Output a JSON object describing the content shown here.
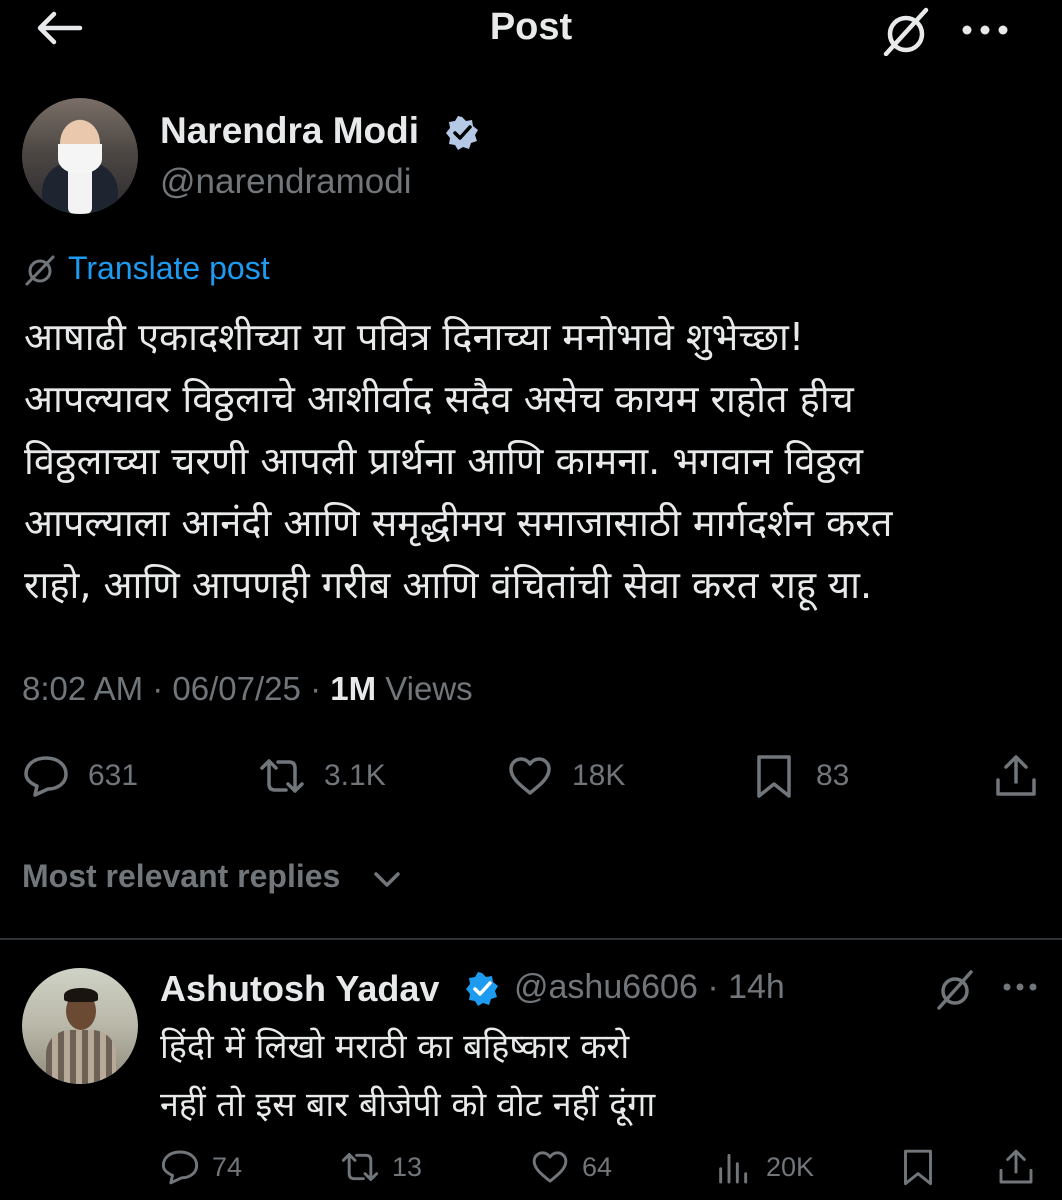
{
  "header": {
    "title": "Post"
  },
  "post": {
    "author_name": "Narendra Modi",
    "handle": "@narendramodi",
    "translate_label": "Translate post",
    "text": "आषाढी एकादशीच्या या पवित्र दिनाच्या मनोभावे शुभेच्छा!\nआपल्यावर विठ्ठलाचे आशीर्वाद सदैव असेच कायम राहोत हीच\nविठ्ठलाच्या चरणी आपली प्रार्थना आणि कामना. भगवान विठ्ठल\nआपल्याला आनंदी आणि समृद्धीमय समाजासाठी मार्गदर्शन करत\nराहो, आणि आपणही गरीब आणि वंचितांची सेवा करत राहू या.",
    "time": "8:02 AM",
    "date": "06/07/25",
    "views_count": "1M",
    "views_label": "Views",
    "stats": {
      "replies": "631",
      "reposts": "3.1K",
      "likes": "18K",
      "bookmarks": "83"
    }
  },
  "replies_section": {
    "sort_label": "Most relevant replies"
  },
  "reply": {
    "author_name": "Ashutosh Yadav",
    "handle": "@ashu6606",
    "age": "14h",
    "text": "हिंदी में लिखो मराठी का बहिष्कार करो\nनहीं तो इस बार बीजेपी को वोट नहीं दूंगा",
    "stats": {
      "replies": "74",
      "reposts": "13",
      "likes": "64",
      "views": "20K"
    }
  },
  "icons": {
    "back": "arrow-left-icon",
    "grok": "grok-slash-icon",
    "more": "ellipsis-icon",
    "verified": "verified-badge-icon",
    "reply": "speech-bubble-icon",
    "repost": "repost-icon",
    "like": "heart-icon",
    "bookmark": "bookmark-icon",
    "share": "share-icon",
    "views": "bar-chart-icon"
  },
  "colors": {
    "background": "#000000",
    "text": "#e7e9ea",
    "muted": "#71767b",
    "link": "#1d9bf0",
    "verified": "#b5c8e6",
    "divider": "#2f3336"
  }
}
